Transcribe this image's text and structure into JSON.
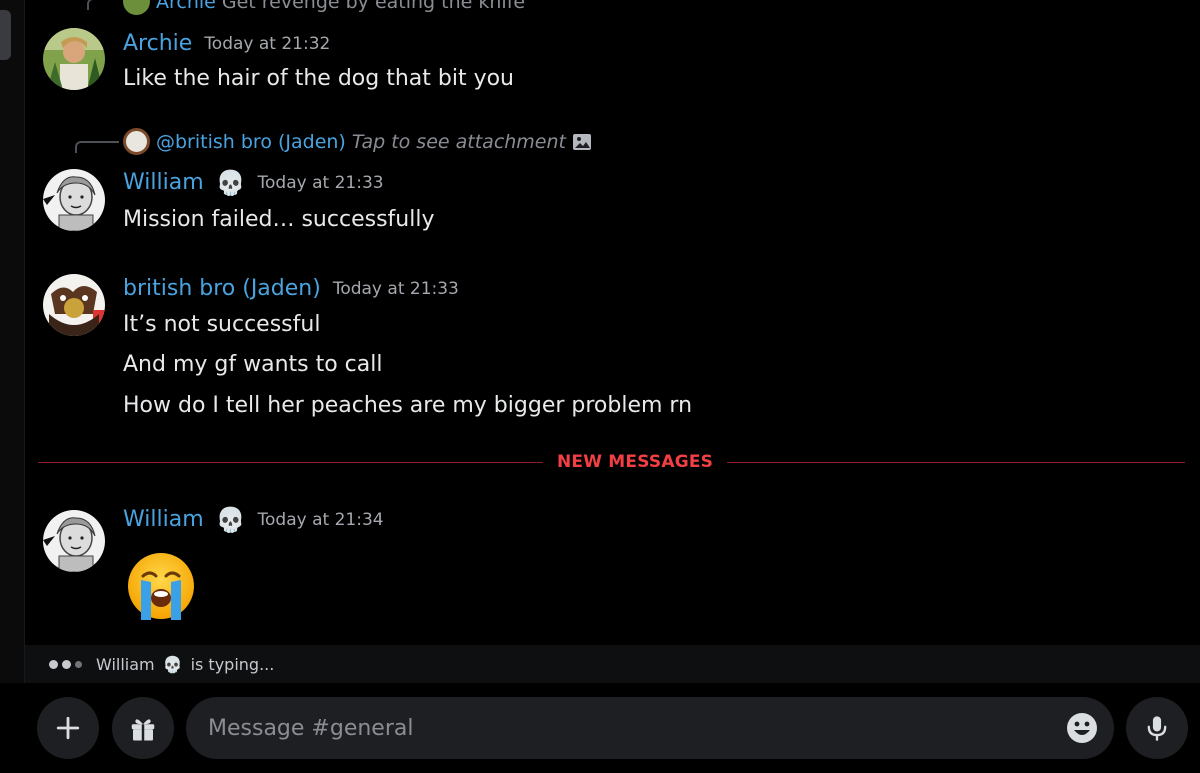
{
  "messages": {
    "top_reply": {
      "name": "Archie",
      "text": "Get revenge by eating the knife"
    },
    "archie": {
      "name": "Archie",
      "time": "Today at 21:32",
      "text": "Like the hair of the dog that bit you"
    },
    "william1_reply": {
      "name": "@british bro (Jaden)",
      "text": "Tap to see attachment"
    },
    "william1": {
      "name": "William",
      "badge": "💀",
      "time": "Today at 21:33",
      "text": "Mission failed… successfully"
    },
    "jaden": {
      "name": "british bro (Jaden)",
      "time": "Today at 21:33",
      "lines": [
        "It’s not successful",
        "And my gf wants to call",
        "How do I tell her peaches are my bigger problem rn"
      ]
    },
    "divider_label": "NEW MESSAGES",
    "william2": {
      "name": "William",
      "badge": "💀",
      "time": "Today at 21:34",
      "emoji": "😭"
    }
  },
  "typing": {
    "name": "William",
    "badge": "💀",
    "suffix": "is typing..."
  },
  "composer": {
    "placeholder": "Message #general"
  },
  "colors": {
    "username": "#4aa3df",
    "new_messages": "#f23f43",
    "background": "#000000"
  },
  "icons": [
    "plus-icon",
    "gift-icon",
    "emoji-icon",
    "microphone-icon",
    "image-icon"
  ]
}
